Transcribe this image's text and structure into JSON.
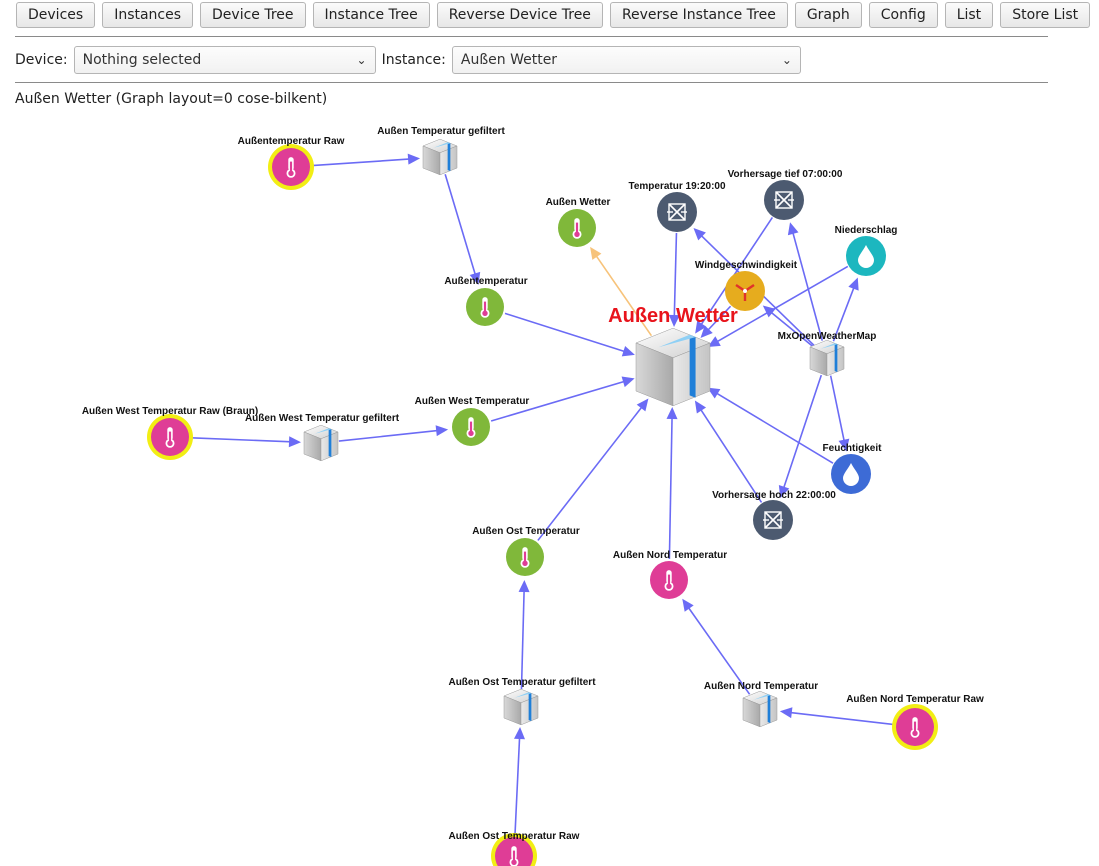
{
  "toolbar": [
    "Devices",
    "Instances",
    "Device Tree",
    "Instance Tree",
    "Reverse Device Tree",
    "Reverse Instance Tree",
    "Graph",
    "Config",
    "List",
    "Store List"
  ],
  "device": {
    "label": "Device:",
    "value": "Nothing selected"
  },
  "instance": {
    "label": "Instance:",
    "value": "Außen Wetter"
  },
  "caption": "Außen Wetter (Graph layout=0 cose-bilkent)",
  "icons": {
    "thermo": "thermometer-icon",
    "module": "module-box-icon",
    "hub": "module-box-icon",
    "forecast": "forecast-icon",
    "drop": "drop-icon",
    "wind": "wind-icon"
  },
  "colors": {
    "edge": "#6b6bf5",
    "edge_highlight": "#f7c37a",
    "pink": "#df3d96",
    "green": "#80b83a",
    "slate": "#4c5a70",
    "teal": "#1cb7bf",
    "blue": "#3d6bd6",
    "gold": "#e6ac1e",
    "yellow_ring": "#f2ee14",
    "title_red": "#e8141c"
  },
  "nodes": [
    {
      "id": "hub",
      "label": "Außen Wetter",
      "kind": "hub"
    },
    {
      "id": "atr",
      "label": "Außentemperatur Raw",
      "kind": "thermo",
      "color": "pink",
      "ring": true
    },
    {
      "id": "atg",
      "label": "Außen Temperatur gefiltert",
      "kind": "module"
    },
    {
      "id": "at",
      "label": "Außentemperatur",
      "kind": "thermo",
      "color": "green"
    },
    {
      "id": "aw",
      "label": "Außen Wetter",
      "kind": "thermo",
      "color": "green"
    },
    {
      "id": "t1920",
      "label": "Temperatur 19:20:00",
      "kind": "forecast"
    },
    {
      "id": "vt",
      "label": "Vorhersage tief 07:00:00",
      "kind": "forecast"
    },
    {
      "id": "ws",
      "label": "Windgeschwindigkeit",
      "kind": "wind"
    },
    {
      "id": "ns",
      "label": "Niederschlag",
      "kind": "drop",
      "color": "teal"
    },
    {
      "id": "owm",
      "label": "MxOpenWeatherMap",
      "kind": "module"
    },
    {
      "id": "awtr",
      "label": "Außen West Temperatur Raw (Braun)",
      "kind": "thermo",
      "color": "pink",
      "ring": true
    },
    {
      "id": "awtg",
      "label": "Außen West Temperatur gefiltert",
      "kind": "module"
    },
    {
      "id": "awt",
      "label": "Außen West Temperatur",
      "kind": "thermo",
      "color": "green"
    },
    {
      "id": "fk",
      "label": "Feuchtigkeit",
      "kind": "drop",
      "color": "blue"
    },
    {
      "id": "vh",
      "label": "Vorhersage hoch 22:00:00",
      "kind": "forecast"
    },
    {
      "id": "aot",
      "label": "Außen Ost Temperatur",
      "kind": "thermo",
      "color": "green"
    },
    {
      "id": "ant",
      "label": "Außen Nord Temperatur",
      "kind": "thermo",
      "color": "pink"
    },
    {
      "id": "aotg",
      "label": "Außen Ost Temperatur gefiltert",
      "kind": "module"
    },
    {
      "id": "antm",
      "label": "Außen Nord Temperatur",
      "kind": "module"
    },
    {
      "id": "antr",
      "label": "Außen Nord Temperatur Raw",
      "kind": "thermo",
      "color": "pink",
      "ring": true
    },
    {
      "id": "aotr",
      "label": "Außen Ost Temperatur Raw",
      "kind": "thermo",
      "color": "pink",
      "ring": true
    }
  ],
  "edges": [
    {
      "from": "atr",
      "to": "atg"
    },
    {
      "from": "atg",
      "to": "at"
    },
    {
      "from": "at",
      "to": "hub"
    },
    {
      "from": "hub",
      "to": "aw",
      "highlight": true
    },
    {
      "from": "owm",
      "to": "t1920"
    },
    {
      "from": "owm",
      "to": "vt"
    },
    {
      "from": "owm",
      "to": "ws"
    },
    {
      "from": "owm",
      "to": "ns"
    },
    {
      "from": "owm",
      "to": "fk"
    },
    {
      "from": "owm",
      "to": "vh"
    },
    {
      "from": "t1920",
      "to": "hub"
    },
    {
      "from": "vt",
      "to": "hub"
    },
    {
      "from": "ws",
      "to": "hub"
    },
    {
      "from": "ns",
      "to": "hub"
    },
    {
      "from": "fk",
      "to": "hub"
    },
    {
      "from": "vh",
      "to": "hub"
    },
    {
      "from": "awtr",
      "to": "awtg"
    },
    {
      "from": "awtg",
      "to": "awt"
    },
    {
      "from": "awt",
      "to": "hub"
    },
    {
      "from": "aot",
      "to": "hub"
    },
    {
      "from": "ant",
      "to": "hub"
    },
    {
      "from": "aotg",
      "to": "aot"
    },
    {
      "from": "aotr",
      "to": "aotg"
    },
    {
      "from": "antm",
      "to": "ant"
    },
    {
      "from": "antr",
      "to": "antm"
    }
  ]
}
